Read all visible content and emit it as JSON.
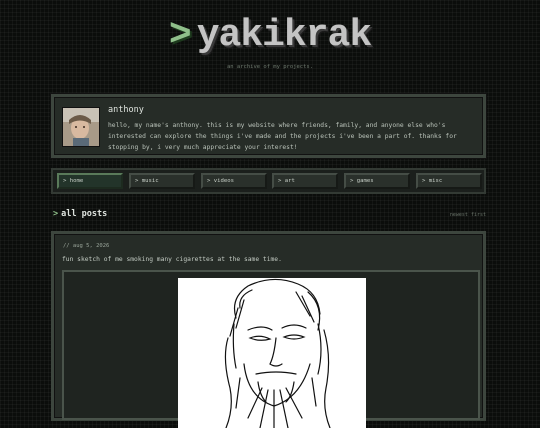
{
  "site": {
    "title": "yakikrak",
    "title_prefix": ">",
    "tagline": "an archive of my projects."
  },
  "profile": {
    "name": "anthony",
    "bio": "hello, my name's anthony. this is my website where friends, family, and anyone else who's interested can explore the things i've made and the projects i've been a part of. thanks for stopping by, i very much appreciate your interest!"
  },
  "nav": {
    "items": [
      {
        "label": "> home",
        "active": true
      },
      {
        "label": "> music",
        "active": false
      },
      {
        "label": "> videos",
        "active": false
      },
      {
        "label": "> art",
        "active": false
      },
      {
        "label": "> games",
        "active": false
      },
      {
        "label": "> misc",
        "active": false
      }
    ]
  },
  "feed": {
    "title_prefix": ">",
    "title": "all posts",
    "sort_label": "newest first"
  },
  "post": {
    "date": "// aug 5, 2026",
    "text": "fun sketch of me smoking many cigarettes at the same time."
  },
  "colors": {
    "accent": "#8fbf8a",
    "background": "#0b0d0b",
    "panel": "#262c27",
    "border": "#3d463e"
  }
}
